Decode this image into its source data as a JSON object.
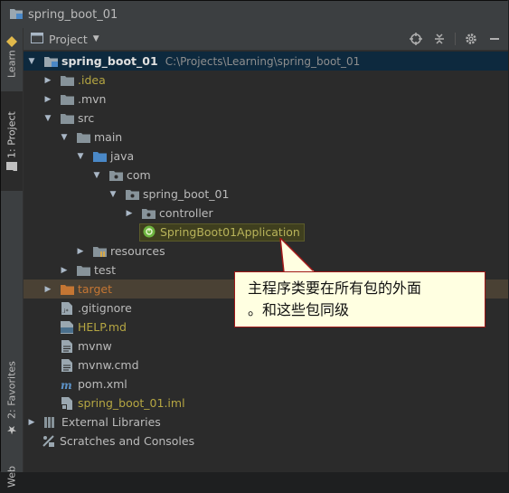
{
  "window": {
    "title": "spring_boot_01"
  },
  "sidebar": {
    "learn": "Learn",
    "project": "1: Project",
    "favorites": "2: Favorites",
    "web": "Web"
  },
  "panel": {
    "view_label": "Project",
    "tools": [
      "locate-icon",
      "collapse-icon",
      "gear-icon",
      "minimize-icon"
    ]
  },
  "tree": {
    "root": {
      "name": "spring_boot_01",
      "path": "C:\\Projects\\Learning\\spring_boot_01"
    },
    "idea": ".idea",
    "mvn": ".mvn",
    "src": "src",
    "main": "main",
    "java": "java",
    "com": "com",
    "pkg": "spring_boot_01",
    "controller": "controller",
    "app_class": "SpringBoot01Application",
    "resources": "resources",
    "test": "test",
    "target": "target",
    "gitignore": ".gitignore",
    "help": "HELP.md",
    "mvnw": "mvnw",
    "mvnw_cmd": "mvnw.cmd",
    "pom": "pom.xml",
    "iml": "spring_boot_01.iml",
    "ext_libs": "External Libraries",
    "scratches": "Scratches and Consoles"
  },
  "callout": {
    "line1": "主程序类要在所有包的外面",
    "line2": "。和这些包同级"
  },
  "colors": {
    "folder_blue": "#4a88c7",
    "folder_gray": "#87939a",
    "excluded_orange": "#c57633",
    "callout_border": "#a01818",
    "callout_bg": "#ffffe1"
  }
}
